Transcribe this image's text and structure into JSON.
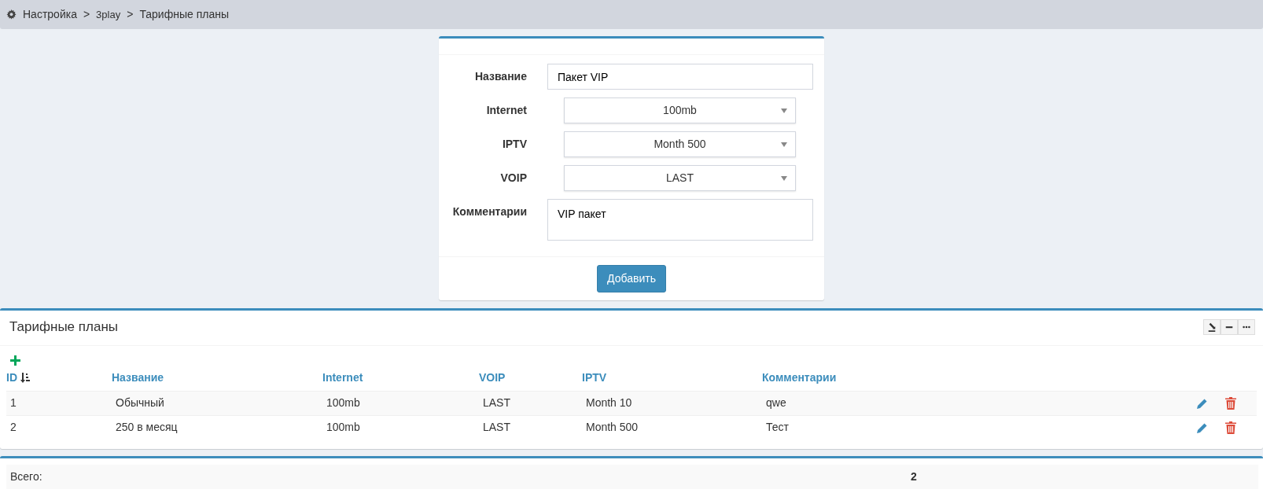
{
  "breadcrumb": [
    {
      "label": "Настройка"
    },
    {
      "label": "3play"
    },
    {
      "label": "Тарифные планы"
    }
  ],
  "breadcrumb_separator": ">",
  "form": {
    "fields": [
      {
        "label": "Название",
        "kind": "text",
        "value": "Пакет VIP"
      },
      {
        "label": "Internet",
        "kind": "select",
        "value": "100mb"
      },
      {
        "label": "IPTV",
        "kind": "select",
        "value": "Month 500"
      },
      {
        "label": "VOIP",
        "kind": "select",
        "value": "LAST"
      },
      {
        "label": "Комментарии",
        "kind": "textarea",
        "value": "VIP пакет"
      }
    ],
    "submit": "Добавить"
  },
  "table_panel": {
    "title": "Тарифные планы",
    "columns": [
      {
        "label": "ID",
        "sorted": true
      },
      {
        "label": "Название",
        "sorted": false
      },
      {
        "label": "Internet",
        "sorted": false
      },
      {
        "label": "VOIP",
        "sorted": false
      },
      {
        "label": "IPTV",
        "sorted": false
      },
      {
        "label": "Комментарии",
        "sorted": false
      }
    ],
    "rows": [
      {
        "cells": [
          "1",
          "Обычный",
          "100mb",
          "LAST",
          "Month 10",
          "qwe"
        ]
      },
      {
        "cells": [
          "2",
          "250 в месяц",
          "100mb",
          "LAST",
          "Month 500",
          "Тест"
        ]
      }
    ]
  },
  "summary": {
    "label": "Всего:",
    "value": "2"
  }
}
